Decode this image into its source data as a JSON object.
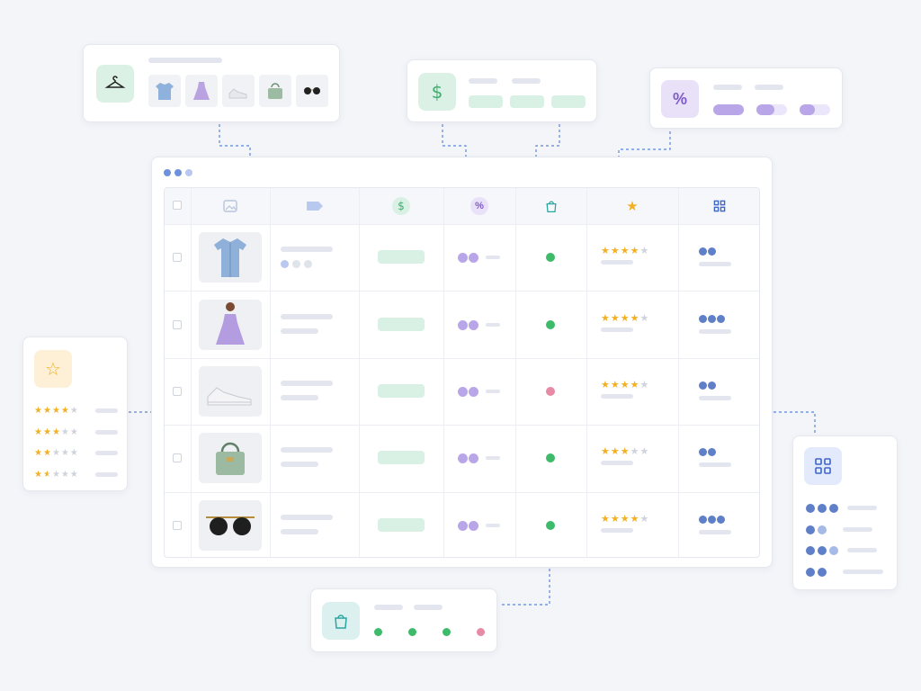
{
  "colors": {
    "accent_green": "#3fae6f",
    "accent_purple": "#8b6fd4",
    "accent_blue": "#4f77d1",
    "star": "#f2b022",
    "status_pink": "#e78aa6",
    "status_green": "#3dbb6a"
  },
  "header_icons": [
    "checkbox",
    "image-icon",
    "tag-icon",
    "dollar-icon",
    "percent-icon",
    "bag-icon",
    "star-icon",
    "grid-icon"
  ],
  "rows": [
    {
      "product": "shirt",
      "dots_gray": 3,
      "status": "green",
      "rating": 4,
      "rating_bars": 1,
      "grid_dots": 2
    },
    {
      "product": "dress",
      "dots_gray": 0,
      "status": "green",
      "rating": 4,
      "rating_bars": 1,
      "grid_dots": 3
    },
    {
      "product": "sneakers",
      "dots_gray": 0,
      "status": "pink",
      "rating": 4,
      "rating_bars": 1,
      "grid_dots": 2
    },
    {
      "product": "handbag",
      "dots_gray": 0,
      "status": "green",
      "rating": 3,
      "rating_bars": 1,
      "grid_dots": 2
    },
    {
      "product": "sunglasses",
      "dots_gray": 0,
      "status": "green",
      "rating": 4,
      "rating_bars": 1,
      "grid_dots": 3
    }
  ],
  "rating_panel": [
    {
      "rating": 4
    },
    {
      "rating": 3
    },
    {
      "rating": 2
    },
    {
      "rating": 1.5
    }
  ],
  "status_panel": [
    "green",
    "green",
    "green",
    "pink"
  ],
  "grid_panel": [
    [
      3,
      "dark"
    ],
    [
      2,
      "mixed"
    ],
    [
      3,
      "mixed"
    ],
    [
      2,
      "dark"
    ]
  ]
}
